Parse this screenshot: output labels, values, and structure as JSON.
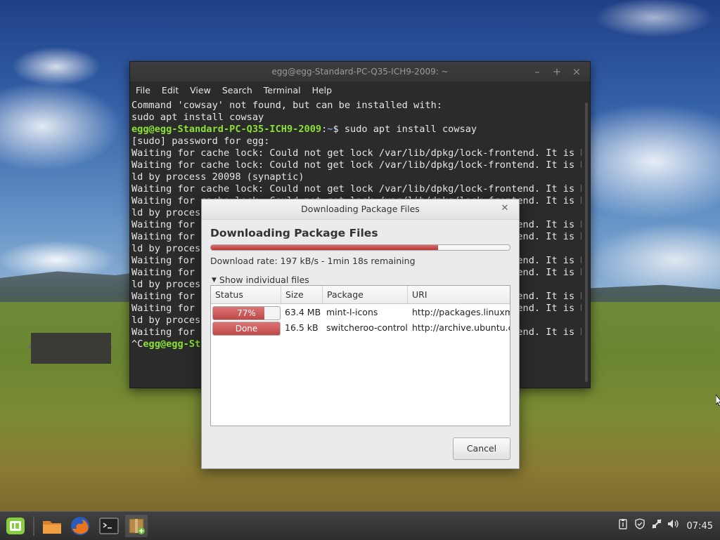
{
  "terminal": {
    "title": "egg@egg-Standard-PC-Q35-ICH9-2009: ~",
    "menu": [
      "File",
      "Edit",
      "View",
      "Search",
      "Terminal",
      "Help"
    ],
    "lines": [
      {
        "text": "Command 'cowsay' not found, but can be installed with:"
      },
      {
        "text": "sudo apt install cowsay"
      },
      {
        "user": "egg@egg-Standard-PC-Q35-ICH9-2009",
        "sep": ":",
        "path": "~",
        "text": "$ sudo apt install cowsay"
      },
      {
        "text": "[sudo] password for egg:"
      },
      {
        "text": "Waiting for cache lock: Could not get lock /var/lib/dpkg/lock-frontend. It is he"
      },
      {
        "text": "Waiting for cache lock: Could not get lock /var/lib/dpkg/lock-frontend. It is he"
      },
      {
        "text": "ld by process 20098 (synaptic)"
      },
      {
        "text": "Waiting for cache lock: Could not get lock /var/lib/dpkg/lock-frontend. It is he"
      },
      {
        "text": "Waiting for cache lock: Could not get lock /var/lib/dpkg/lock-frontend. It is he"
      },
      {
        "text": "ld by process 20098 (synaptic)"
      },
      {
        "text": "Waiting for cache lock: Could not get lock /var/lib/dpkg/lock-frontend. It is he"
      },
      {
        "text": "Waiting for cache lock: Could not get lock /var/lib/dpkg/lock-frontend. It is he"
      },
      {
        "text": "ld by process 20098 (synaptic)"
      },
      {
        "text": "Waiting for cache lock: Could not get lock /var/lib/dpkg/lock-frontend. It is he"
      },
      {
        "text": "Waiting for cache lock: Could not get lock /var/lib/dpkg/lock-frontend. It is he"
      },
      {
        "text": "ld by process 20098 (synaptic)"
      },
      {
        "text": "Waiting for cache lock: Could not get lock /var/lib/dpkg/lock-frontend. It is he"
      },
      {
        "text": "Waiting for cache lock: Could not get lock /var/lib/dpkg/lock-frontend. It is he"
      },
      {
        "text": "ld by process 20098 (synaptic)"
      },
      {
        "text": "Waiting for cache lock: Could not get lock /var/lib/dpkg/lock-frontend. It is he"
      },
      {
        "prefix": "^C",
        "user": "egg@egg-Standard-PC-Q35-ICH9-2009",
        "sep": ":",
        "path": "~",
        "text": "$ "
      }
    ]
  },
  "dialog": {
    "title": "Downloading Package Files",
    "heading": "Downloading Package Files",
    "overall_progress": 0.76,
    "rate_text": "Download rate: 197 kB/s - 1min 18s remaining",
    "expander_label": "Show individual files",
    "columns": [
      "Status",
      "Size",
      "Package",
      "URI"
    ],
    "rows": [
      {
        "status": "77%",
        "progress": 0.77,
        "size": "63.4 MB",
        "package": "mint-l-icons",
        "uri": "http://packages.linuxmint.com"
      },
      {
        "status": "Done",
        "progress": 1.0,
        "size": "16.5 kB",
        "package": "switcheroo-control",
        "uri": "http://archive.ubuntu.com"
      }
    ],
    "cancel_label": "Cancel"
  },
  "taskbar": {
    "apps": [
      "mint-menu-icon",
      "files-icon",
      "firefox-icon",
      "terminal-icon",
      "package-installer-icon"
    ],
    "tray": [
      "clipboard-icon",
      "shield-icon",
      "network-icon",
      "volume-icon"
    ],
    "clock": "07:45"
  },
  "colors": {
    "prompt_user": "#8ae234",
    "prompt_path": "#729fcf",
    "progress": "#c04848",
    "mint_green": "#87cf3e"
  }
}
